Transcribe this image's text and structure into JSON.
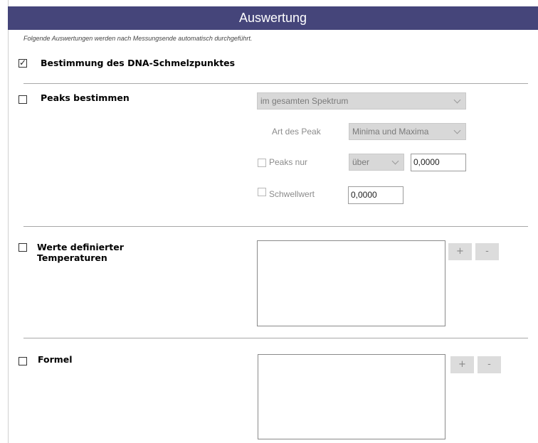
{
  "header": {
    "title": "Auswertung"
  },
  "subtitle": "Folgende Auswertungen werden nach Messungsende automatisch durchgeführt.",
  "dna": {
    "label": "Bestimmung des DNA-Schmelzpunktes",
    "checked": true
  },
  "peaks": {
    "label": "Peaks bestimmen",
    "checked": false,
    "range_select": "im gesamten Spektrum",
    "art_label": "Art des Peak",
    "art_select": "Minima und Maxima",
    "peaks_nur_label": "Peaks nur",
    "direction_select": "über",
    "peaks_nur_value": "0,0000",
    "schwellwert_label": "Schwellwert",
    "schwellwert_value": "0,0000"
  },
  "werte": {
    "label_line1": "Werte definierter",
    "label_line2": "Temperaturen",
    "checked": false,
    "add_label": "+",
    "remove_label": "-"
  },
  "formel": {
    "label": "Formel",
    "checked": false,
    "add_label": "+",
    "remove_label": "-"
  },
  "colors": {
    "header_bg": "#45457a"
  }
}
